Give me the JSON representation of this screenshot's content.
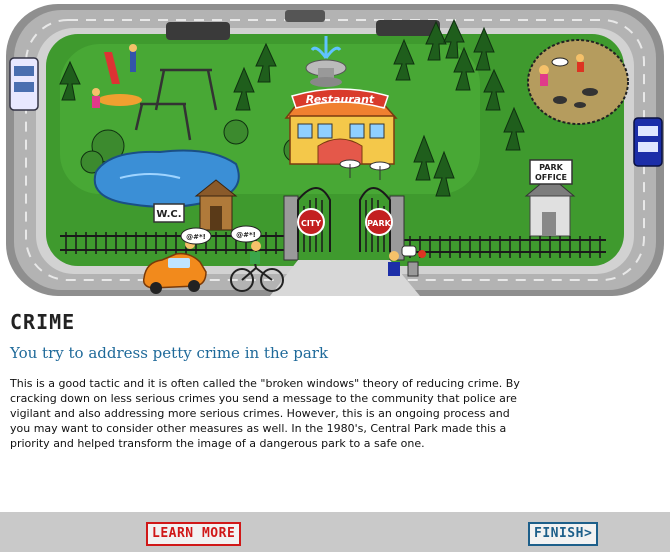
{
  "scene": {
    "restaurant_sign": "Restaurant",
    "wc_sign": "W.C.",
    "park_office_sign": [
      "PARK",
      "OFFICE"
    ],
    "gate_left_sign": "CITY",
    "gate_right_sign": "PARK",
    "speech_1": "@#*!",
    "speech_2": "@#*!"
  },
  "section": {
    "title": "CRIME",
    "choice": "You try to address petty crime in the park",
    "body": "This is a good tactic and it is often called the \"broken windows\" theory of reducing crime. By cracking down on less serious crimes you send a message to the community that police are vigilant and also addressing more serious crimes. However, this is an ongoing process and you may want to consider other measures as well. In the 1980's, Central Park made this a priority and helped transform the image of a dangerous park to a safe one."
  },
  "footer": {
    "learn_more": "LEARN MORE",
    "finish": "FINISH>"
  },
  "colors": {
    "grass": "#3f9a2e",
    "road": "#a9a9a9",
    "pond": "#3b8fd6",
    "learn_more": "#d01818",
    "finish": "#1d5f8a"
  }
}
